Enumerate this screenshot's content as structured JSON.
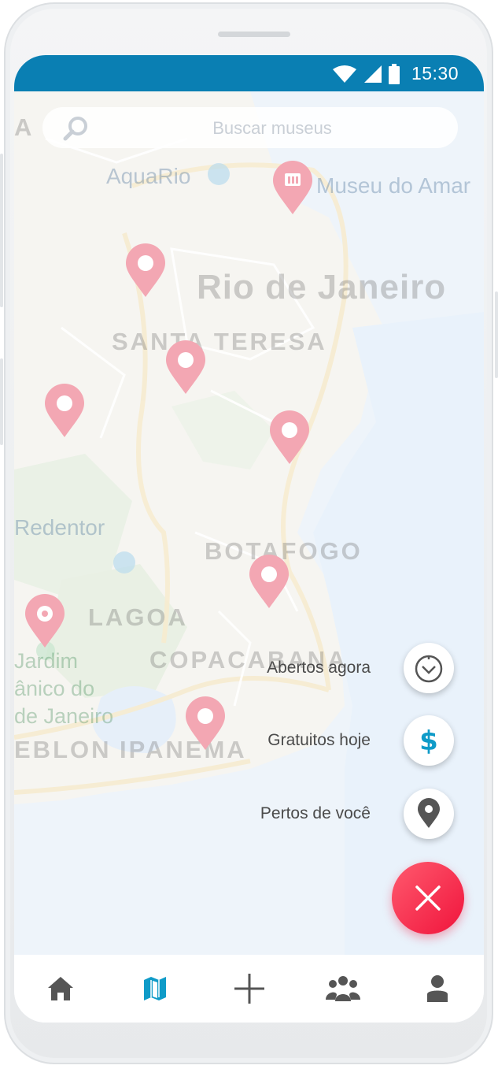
{
  "status_bar": {
    "time": "15:30"
  },
  "search": {
    "placeholder": "Buscar museus"
  },
  "map": {
    "labels": {
      "rio": "Rio de Janeiro",
      "santa_teresa": "SANTA TERESA",
      "botafogo": "BOTAFOGO",
      "lagoa": "LAGOA",
      "copacabana": "COPACABANA",
      "ipanema": "IPANEMA",
      "leblon": "EBLON",
      "aquario": "AquaRio",
      "museu_amanha": "Museu do Amar",
      "redentor": "Redentor",
      "jardim_1": "Jardim",
      "jardim_2": "ânico do",
      "jardim_3": "de Janeiro",
      "corner": "A"
    },
    "pin_color": "#f3a7b3"
  },
  "filters": [
    {
      "label": "Abertos agora",
      "icon": "clock-icon"
    },
    {
      "label": "Gratuitos hoje",
      "icon": "dollar-icon"
    },
    {
      "label": "Pertos de você",
      "icon": "location-pin-icon"
    }
  ],
  "close_fab": {
    "icon": "close-icon"
  },
  "bottom_nav": [
    {
      "name": "home",
      "icon": "home-icon"
    },
    {
      "name": "map",
      "icon": "map-icon",
      "active": true
    },
    {
      "name": "add",
      "icon": "plus-icon"
    },
    {
      "name": "community",
      "icon": "group-icon"
    },
    {
      "name": "profile",
      "icon": "user-icon"
    }
  ],
  "colors": {
    "status_bar": "#0a7fb3",
    "accent": "#0f9bc8",
    "fab": "#f0143c",
    "nav_icon": "#555555"
  }
}
